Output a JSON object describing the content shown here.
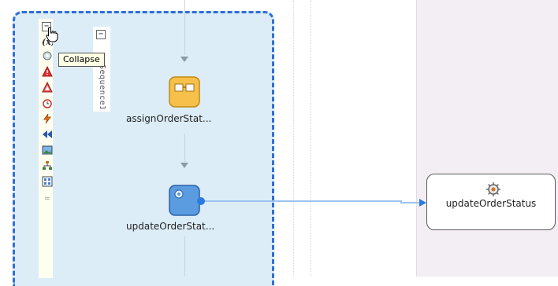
{
  "tooltip": {
    "text": "Collapse"
  },
  "sequence": {
    "label": "Sequence1"
  },
  "activities": [
    {
      "label": "assignOrderStat..."
    },
    {
      "label": "updateOrderStat..."
    }
  ],
  "partner_link": {
    "label": "updateOrderStatus"
  },
  "colors": {
    "scope_fill": "#ddedf7",
    "scope_border": "#2f6fd8",
    "partner_lane": "#f3eef3",
    "connector": "#9cc3ef"
  }
}
